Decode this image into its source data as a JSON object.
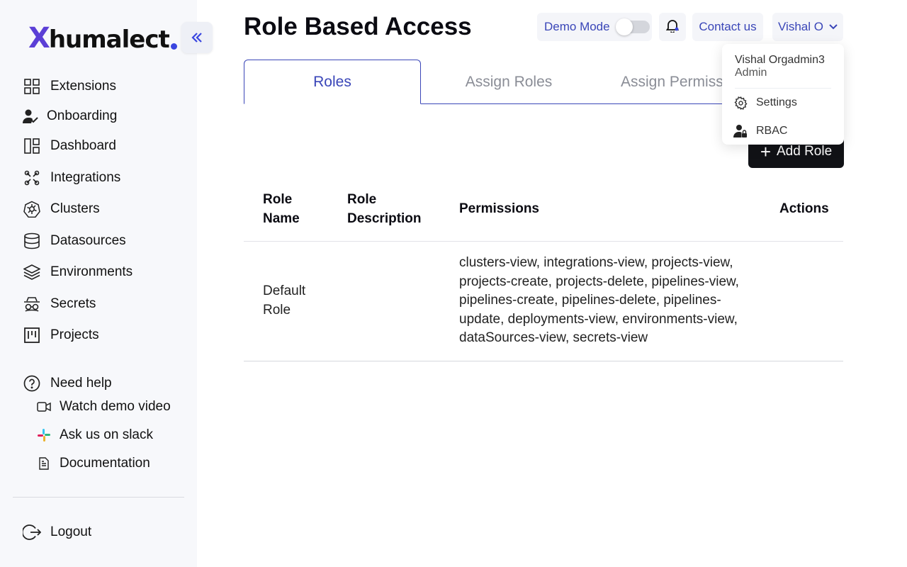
{
  "brand": {
    "mark": "X",
    "name": "humalect"
  },
  "sidebar": {
    "items": [
      {
        "label": "Extensions",
        "icon": "grid-icon"
      },
      {
        "label": "Onboarding",
        "icon": "user-check-icon"
      },
      {
        "label": "Dashboard",
        "icon": "layout-icon"
      },
      {
        "label": "Integrations",
        "icon": "integrations-icon"
      },
      {
        "label": "Clusters",
        "icon": "kubernetes-icon"
      },
      {
        "label": "Datasources",
        "icon": "database-icon"
      },
      {
        "label": "Environments",
        "icon": "layers-icon"
      },
      {
        "label": "Secrets",
        "icon": "spy-icon"
      },
      {
        "label": "Projects",
        "icon": "kanban-icon"
      }
    ],
    "help": {
      "label": "Need help",
      "items": [
        {
          "label": "Watch demo video",
          "icon": "video-icon"
        },
        {
          "label": "Ask us on slack",
          "icon": "slack-icon"
        },
        {
          "label": "Documentation",
          "icon": "document-icon"
        }
      ]
    },
    "logout_label": "Logout"
  },
  "header": {
    "title": "Role Based Access",
    "demo_mode_label": "Demo Mode",
    "demo_mode_on": false,
    "contact_label": "Contact us",
    "user_label": "Vishal O"
  },
  "tabs": [
    {
      "label": "Roles",
      "active": true
    },
    {
      "label": "Assign Roles",
      "active": false
    },
    {
      "label": "Assign Permiss",
      "active": false
    }
  ],
  "add_role_label": "Add Role",
  "table": {
    "headers": {
      "role_name": [
        "Role",
        "Name"
      ],
      "role_description": [
        "Role",
        "Description"
      ],
      "permissions": "Permissions",
      "actions": "Actions"
    },
    "rows": [
      {
        "role_name": [
          "Default",
          "Role"
        ],
        "role_description": "",
        "permissions": [
          "clusters-view, integrations-view, projects-view,",
          "projects-create, projects-delete, pipelines-view,",
          "pipelines-create, pipelines-delete, pipelines-",
          "update, deployments-view, environments-view,",
          "dataSources-view, secrets-view"
        ]
      }
    ]
  },
  "user_menu": {
    "name": "Vishal Orgadmin3",
    "role": "Admin",
    "items": [
      {
        "label": "Settings",
        "icon": "gear-icon"
      },
      {
        "label": "RBAC",
        "icon": "user-lock-icon"
      }
    ]
  },
  "colors": {
    "accent": "#3a46b8",
    "logo_mark": "#5b3fd6",
    "dark_button": "#111216",
    "sidebar_bg": "#f7f8fb"
  }
}
